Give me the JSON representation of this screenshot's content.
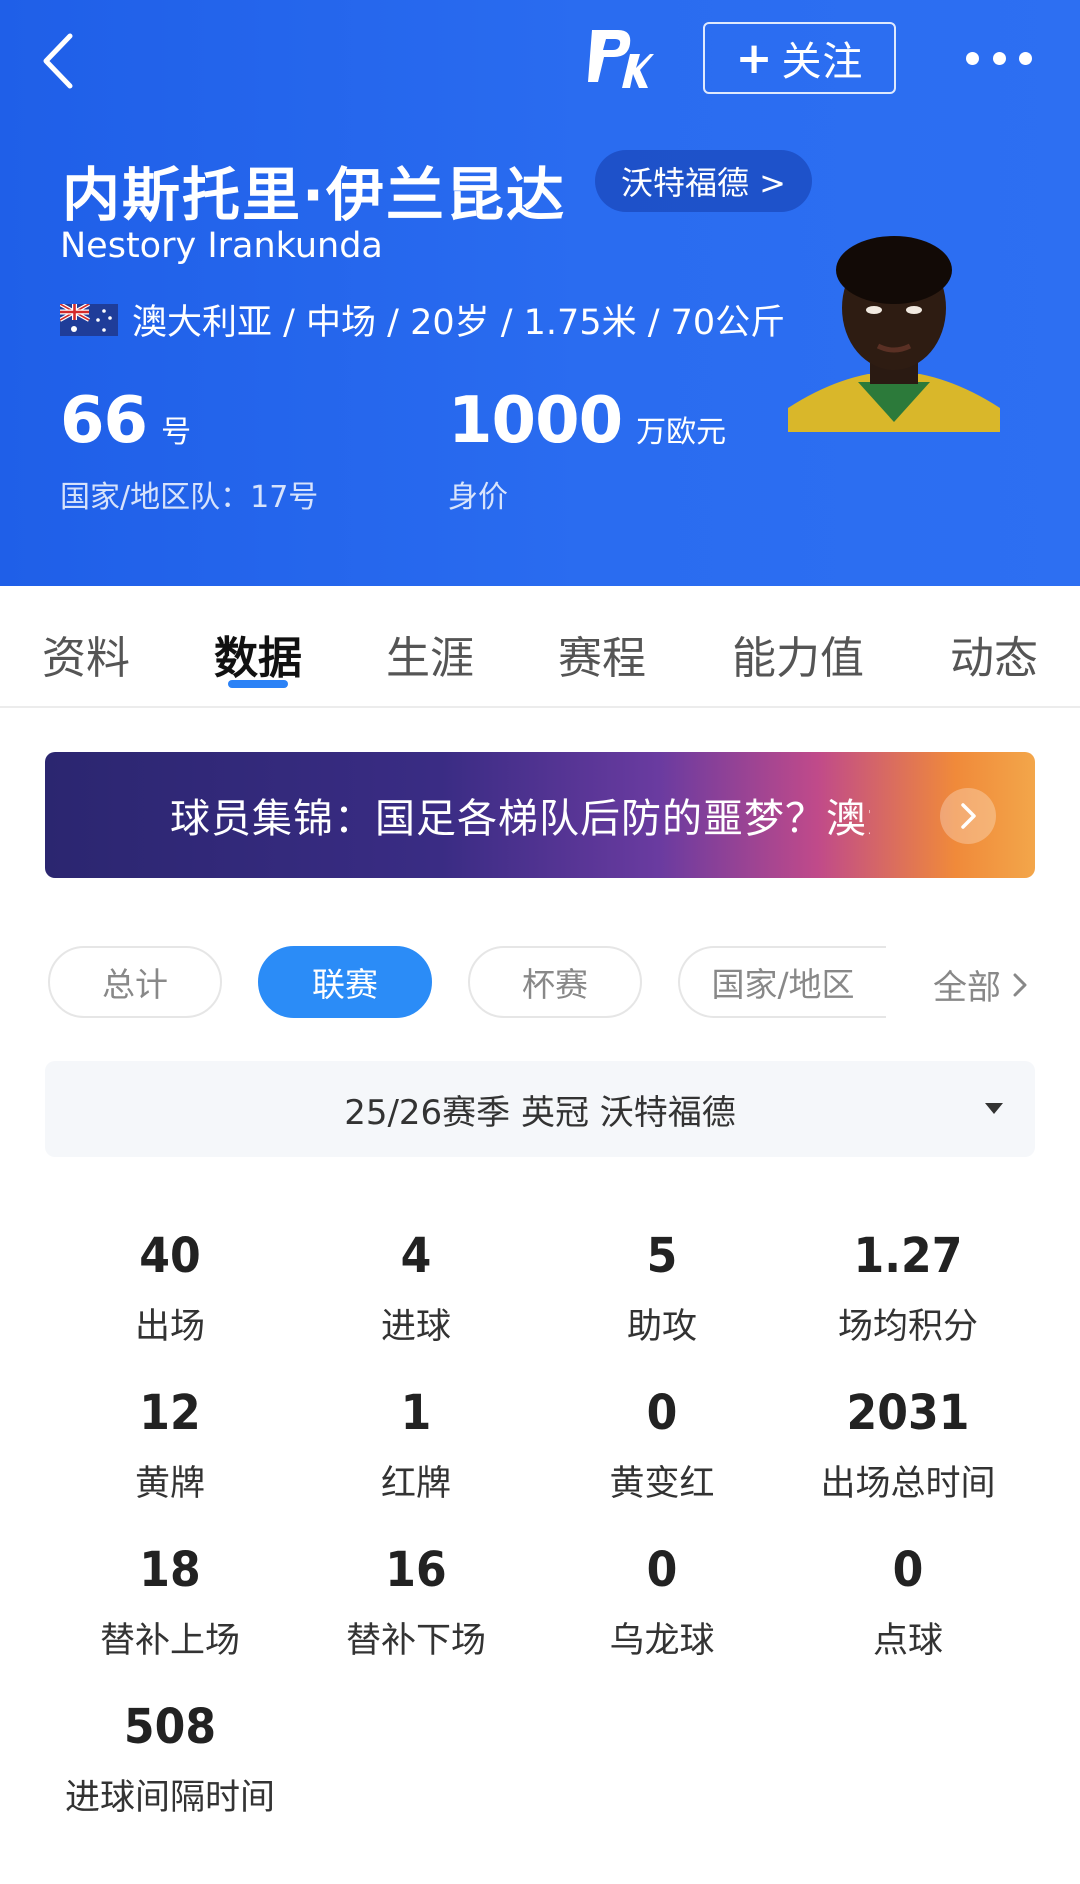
{
  "header": {
    "follow_plus": "+",
    "follow_label": "关注",
    "logo_text": "PK",
    "player_name_cn": "内斯托里·伊兰昆达",
    "club": "沃特福德 >",
    "player_name_en": "Nestory Irankunda",
    "info": "澳大利亚 / 中场 / 20岁 / 1.75米 / 70公斤",
    "shirt_number": "66",
    "shirt_unit": "号",
    "national_number": "国家/地区队：17号",
    "market_value": "1000",
    "market_value_unit": "万欧元",
    "market_value_label": "身价",
    "colors": {
      "bg_start": "#1f5fe8",
      "bg_end": "#2d6ff2"
    }
  },
  "tabs": [
    "资料",
    "数据",
    "生涯",
    "赛程",
    "能力值",
    "动态"
  ],
  "active_tab": "数据",
  "banner": {
    "text": "球员集锦：国足各梯队后防的噩梦？澳大利亚天才边锋"
  },
  "filters": {
    "chips": [
      "总计",
      "联赛",
      "杯赛",
      "国家/地区"
    ],
    "active": "联赛",
    "all_label": "全部"
  },
  "season": {
    "label": "25/26赛季 英冠 沃特福德"
  },
  "stats": [
    {
      "value": "40",
      "label": "出场"
    },
    {
      "value": "4",
      "label": "进球"
    },
    {
      "value": "5",
      "label": "助攻"
    },
    {
      "value": "1.27",
      "label": "场均积分"
    },
    {
      "value": "12",
      "label": "黄牌"
    },
    {
      "value": "1",
      "label": "红牌"
    },
    {
      "value": "0",
      "label": "黄变红"
    },
    {
      "value": "2031",
      "label": "出场总时间"
    },
    {
      "value": "18",
      "label": "替补上场"
    },
    {
      "value": "16",
      "label": "替补下场"
    },
    {
      "value": "0",
      "label": "乌龙球"
    },
    {
      "value": "0",
      "label": "点球"
    },
    {
      "value": "508",
      "label": "进球间隔时间"
    }
  ],
  "accent_color": "#2b8cf7"
}
